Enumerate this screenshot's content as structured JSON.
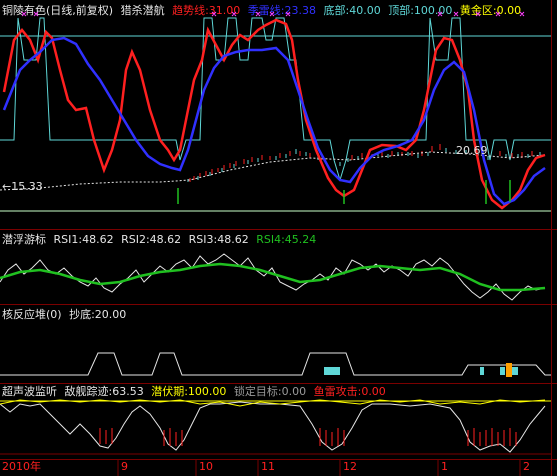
{
  "colors": {
    "white": "#e6e6e6",
    "yellow": "#ffff00",
    "red": "#ff2020",
    "blue": "#3030ff",
    "cyan": "#5fd7d7",
    "green": "#20c020",
    "magenta": "#ff40ff",
    "border": "#7a0000",
    "base_line": "#c8ffc8"
  },
  "pane1": {
    "stock_title": "铜陵有色(日线,前复权)",
    "indicator_name": "猎杀潜航",
    "trend_label": "趋势线:31.00",
    "thunder_label": "季雷线:23.38",
    "bottom_label": "底部:40.00",
    "top_label": "顶部:100.00",
    "gold_label": "黄金区:0.00",
    "price_high": "20.69",
    "price_low": "15.33"
  },
  "pane2": {
    "name": "潜浮游标",
    "rsi1": "RSI1:48.62",
    "rsi2": "RSI2:48.62",
    "rsi3": "RSI3:48.62",
    "rsi4": "RSI4:45.24"
  },
  "pane3": {
    "name": "核反应堆(0)",
    "bottom_buy": "抄底:20.00"
  },
  "pane4": {
    "name": "超声波监听",
    "track": "敌舰踪迹:63.53",
    "latent": "潜伏期:100.00",
    "lock": "锁定目标:0.00",
    "torpedo": "鱼雷攻击:0.00"
  },
  "xaxis": {
    "labels": [
      "2010年",
      "9",
      "10",
      "11",
      "12",
      "1",
      "2"
    ]
  }
}
